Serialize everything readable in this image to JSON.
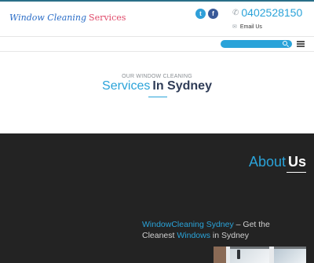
{
  "colors": {
    "accent": "#2aa3d9",
    "dark_bg": "#232323",
    "title_dark": "#2f3c57",
    "logo_blue": "#2a6dc7",
    "logo_pink": "#e04a6a",
    "twitter": "#2f9fd9",
    "facebook": "#3a5a98"
  },
  "header": {
    "logo_part1": "Window Cleaning",
    "logo_part2": "Services",
    "social": [
      {
        "icon": "twitter-icon",
        "glyph": "t"
      },
      {
        "icon": "facebook-icon",
        "glyph": "f"
      }
    ],
    "phone_icon": "phone-icon",
    "phone": "0402528150",
    "email_icon": "envelope-icon",
    "email_label": "Email Us"
  },
  "nav": {
    "search_placeholder": "",
    "search_icon": "search-icon",
    "menu_icon": "hamburger-menu-icon"
  },
  "services_section": {
    "kicker": "OUR WINDOW CLEANING",
    "title_part1": "Services",
    "title_part2": "In Sydney"
  },
  "about_section": {
    "title_part1": "About",
    "title_part2": "Us",
    "link1": "WindowCleaning Sydney",
    "text1": " – Get the Cleanest ",
    "link2": "Windows",
    "text2": " in Sydney"
  }
}
